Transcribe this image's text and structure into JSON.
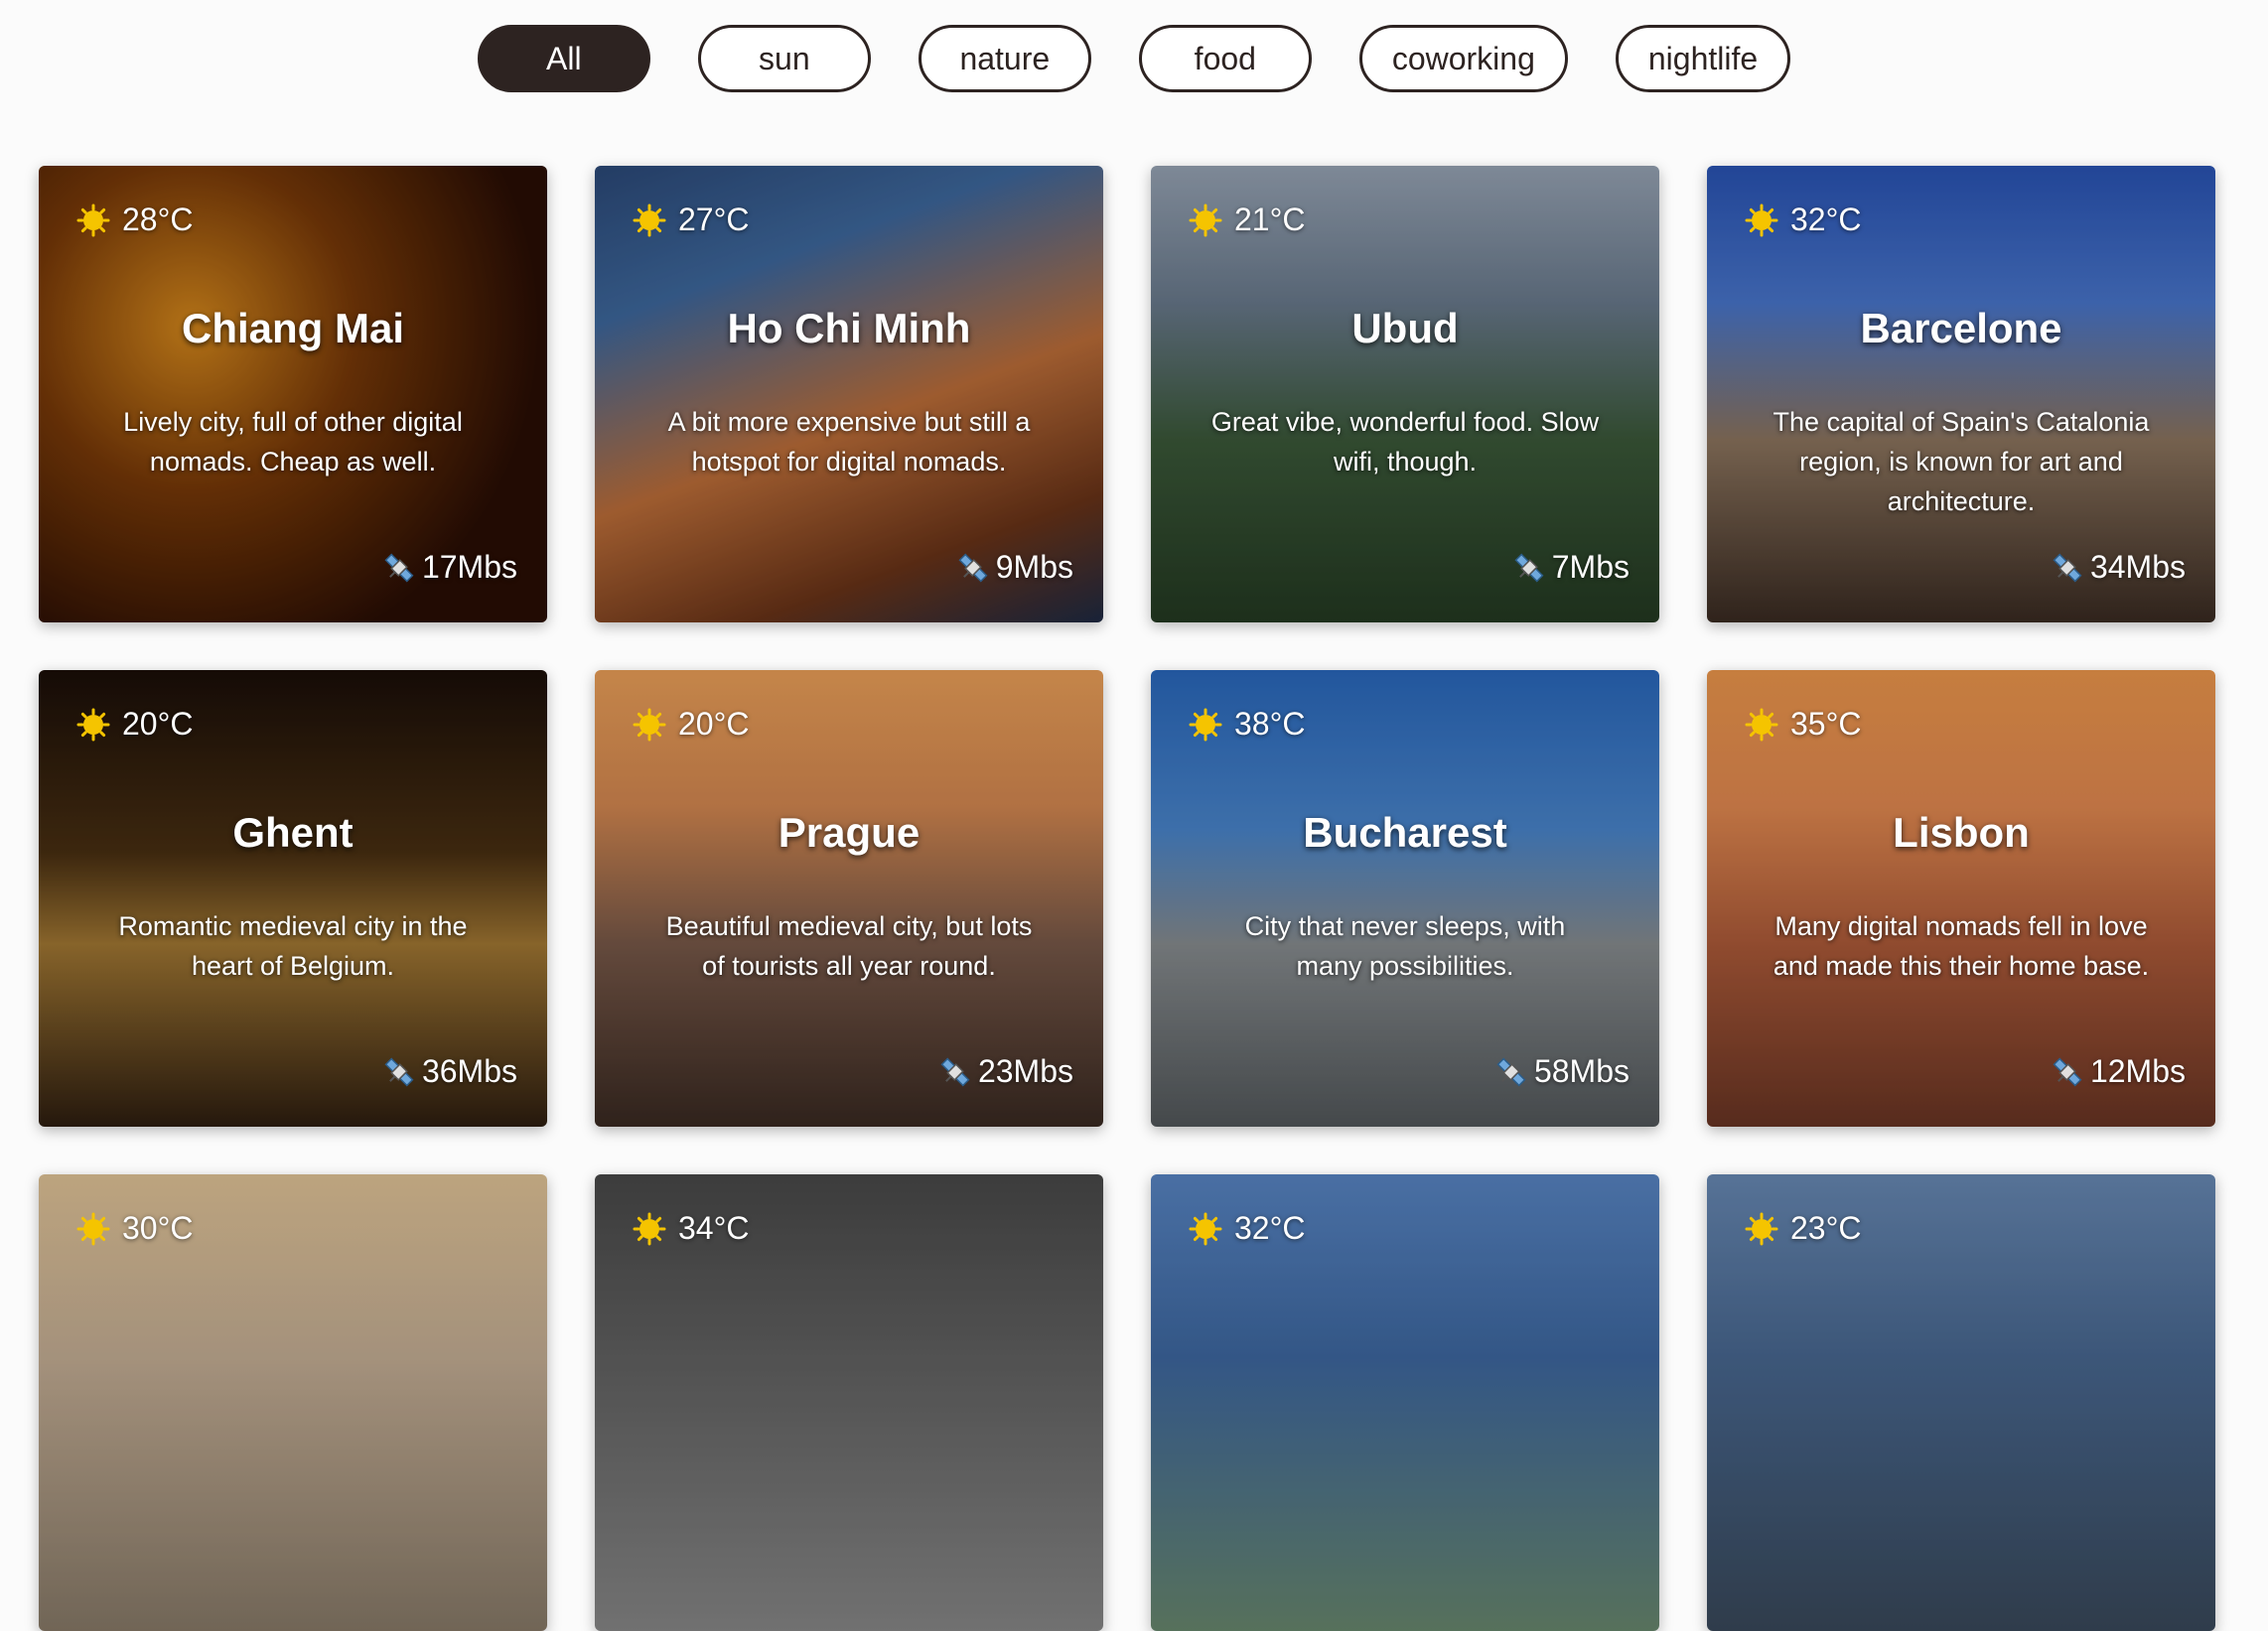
{
  "filters": [
    {
      "label": "All",
      "active": true
    },
    {
      "label": "sun",
      "active": false
    },
    {
      "label": "nature",
      "active": false
    },
    {
      "label": "food",
      "active": false
    },
    {
      "label": "coworking",
      "active": false
    },
    {
      "label": "nightlife",
      "active": false
    }
  ],
  "cities": [
    {
      "name": "Chiang Mai",
      "temp": "28°C",
      "desc": "Lively city, full of other digital nomads. Cheap as well.",
      "speed": "17Mbs"
    },
    {
      "name": "Ho Chi Minh",
      "temp": "27°C",
      "desc": "A bit more expensive but still a hotspot for digital nomads.",
      "speed": "9Mbs"
    },
    {
      "name": "Ubud",
      "temp": "21°C",
      "desc": "Great vibe, wonderful food. Slow wifi, though.",
      "speed": "7Mbs"
    },
    {
      "name": "Barcelone",
      "temp": "32°C",
      "desc": "The capital of Spain's Catalonia region, is known for art and architecture.",
      "speed": "34Mbs"
    },
    {
      "name": "Ghent",
      "temp": "20°C",
      "desc": "Romantic medieval city in the heart of Belgium.",
      "speed": "36Mbs"
    },
    {
      "name": "Prague",
      "temp": "20°C",
      "desc": "Beautiful medieval city, but lots of tourists all year round.",
      "speed": "23Mbs"
    },
    {
      "name": "Bucharest",
      "temp": "38°C",
      "desc": "City that never sleeps, with many possibilities.",
      "speed": "58Mbs"
    },
    {
      "name": "Lisbon",
      "temp": "35°C",
      "desc": "Many digital nomads fell in love and made this their home base.",
      "speed": "12Mbs"
    },
    {
      "name": "",
      "temp": "30°C",
      "desc": "",
      "speed": ""
    },
    {
      "name": "",
      "temp": "34°C",
      "desc": "",
      "speed": ""
    },
    {
      "name": "",
      "temp": "32°C",
      "desc": "",
      "speed": ""
    },
    {
      "name": "",
      "temp": "23°C",
      "desc": "",
      "speed": ""
    }
  ],
  "icons": {
    "temperature": "sun-icon",
    "wifi_speed": "satellite-icon"
  },
  "colors": {
    "accent": "#2d2321",
    "sun": "#f5c400"
  }
}
